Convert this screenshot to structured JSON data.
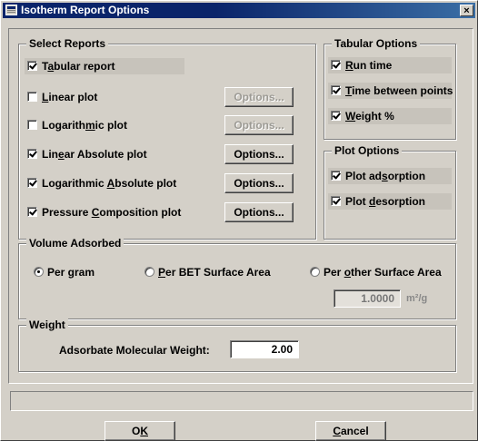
{
  "window": {
    "title": "Isotherm Report Options",
    "close_label": "×"
  },
  "select_reports": {
    "legend": "Select Reports",
    "items": [
      {
        "pre": "T",
        "u": "a",
        "post": "bular report",
        "checked": true
      },
      {
        "pre": "",
        "u": "L",
        "post": "inear plot",
        "checked": false
      },
      {
        "pre": "Logarith",
        "u": "m",
        "post": "ic plot",
        "checked": false
      },
      {
        "pre": "Lin",
        "u": "e",
        "post": "ar Absolute plot",
        "checked": true
      },
      {
        "pre": "Logarithmic ",
        "u": "A",
        "post": "bsolute plot",
        "checked": true
      },
      {
        "pre": "Pressure ",
        "u": "C",
        "post": "omposition plot",
        "checked": true
      }
    ],
    "buttons": [
      {
        "label": "Options...",
        "enabled": false
      },
      {
        "label": "Options...",
        "enabled": false
      },
      {
        "label": "Options...",
        "enabled": true
      },
      {
        "label": "Options...",
        "enabled": true
      },
      {
        "label": "Options...",
        "enabled": true
      }
    ]
  },
  "tabular_options": {
    "legend": "Tabular Options",
    "items": [
      {
        "pre": "",
        "u": "R",
        "post": "un time",
        "checked": true
      },
      {
        "pre": "",
        "u": "T",
        "post": "ime between points",
        "checked": true
      },
      {
        "pre": "",
        "u": "W",
        "post": "eight %",
        "checked": true
      }
    ]
  },
  "plot_options": {
    "legend": "Plot Options",
    "items": [
      {
        "pre": "Plot ad",
        "u": "s",
        "post": "orption",
        "checked": true
      },
      {
        "pre": "Plot ",
        "u": "d",
        "post": "esorption",
        "checked": true
      }
    ]
  },
  "volume_adsorbed": {
    "legend": "Volume Adsorbed",
    "radios": [
      {
        "pre": "Per gram",
        "u": "",
        "post": "",
        "selected": true
      },
      {
        "pre": "",
        "u": "P",
        "post": "er BET Surface Area",
        "selected": false
      },
      {
        "pre": "Per ",
        "u": "o",
        "post": "ther Surface Area",
        "selected": false
      }
    ],
    "area_value": "1.0000",
    "area_unit": "m²/g"
  },
  "weight": {
    "legend": "Weight",
    "label": "Adsorbate Molecular Weight:",
    "value": "2.00"
  },
  "footer": {
    "ok_pre": "O",
    "ok_u": "K",
    "ok_post": "",
    "cancel_pre": "",
    "cancel_u": "C",
    "cancel_post": "ancel"
  }
}
